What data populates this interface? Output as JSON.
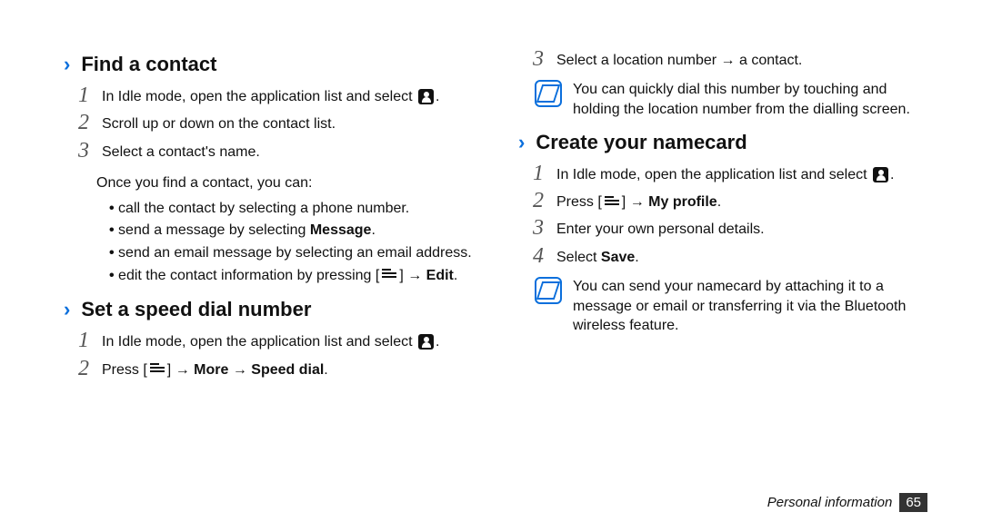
{
  "left": {
    "sec1": {
      "heading": "Find a contact",
      "step1": "In Idle mode, open the application list and select",
      "step1_period": ".",
      "step2": "Scroll up or down on the contact list.",
      "step3": "Select a contact's name.",
      "intro": "Once you find a contact, you can:",
      "b1": "call the contact by selecting a phone number.",
      "b2_pre": "send a message by selecting ",
      "b2_bold": "Message",
      "b2_post": ".",
      "b3": "send an email message by selecting an email address.",
      "b4_pre": "edit the contact information by pressing [",
      "b4_arrow": "] → ",
      "b4_bold": "Edit",
      "b4_post": "."
    },
    "sec2": {
      "heading": "Set a speed dial number",
      "step1": "In Idle mode, open the application list and select",
      "step1_period": ".",
      "step2_pre": "Press [",
      "step2_arrow": "] → ",
      "step2_bold1": "More",
      "step2_mid": " → ",
      "step2_bold2": "Speed dial",
      "step2_post": "."
    }
  },
  "right": {
    "top": {
      "step3": "Select a location number → a contact.",
      "note": "You can quickly dial this number by touching and holding the location number from the dialling screen."
    },
    "sec3": {
      "heading": "Create your namecard",
      "step1": "In Idle mode, open the application list and select",
      "step1_period": ".",
      "step2_pre": "Press [",
      "step2_arrow": "] → ",
      "step2_bold": "My profile",
      "step2_post": ".",
      "step3": "Enter your own personal details.",
      "step4_pre": "Select ",
      "step4_bold": "Save",
      "step4_post": ".",
      "note": "You can send your namecard by attaching it to a message or email or transferring it via the Bluetooth wireless feature."
    }
  },
  "footer": {
    "label": "Personal information",
    "page": "65"
  }
}
